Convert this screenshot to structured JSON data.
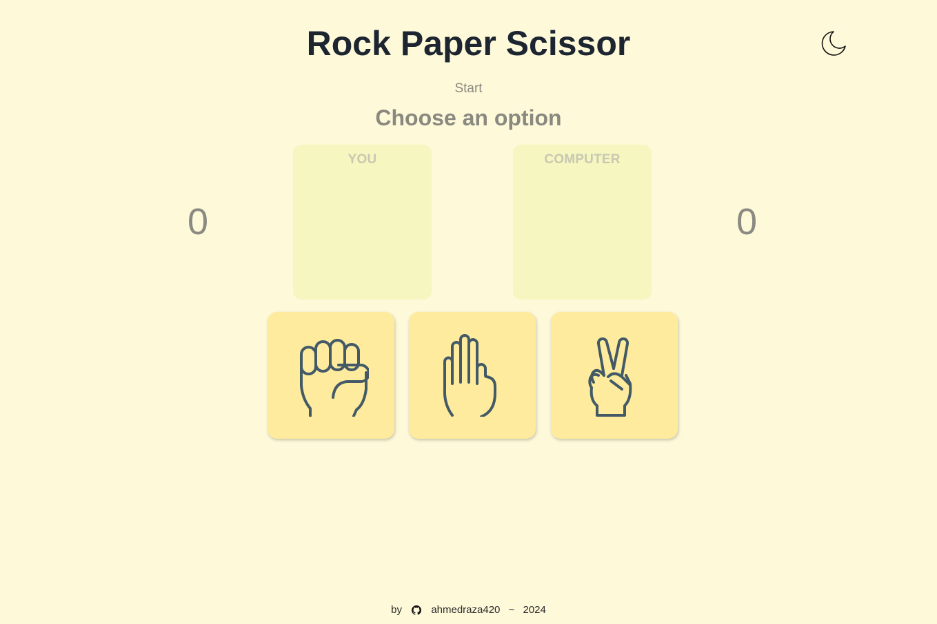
{
  "header": {
    "title": "Rock Paper Scissor",
    "theme_toggle_icon": "moon-icon"
  },
  "game": {
    "status": "Start",
    "prompt": "Choose an option",
    "player": {
      "label": "YOU",
      "score": "0"
    },
    "computer": {
      "label": "COMPUTER",
      "score": "0"
    },
    "options": [
      {
        "name": "rock",
        "icon": "fist-icon"
      },
      {
        "name": "paper",
        "icon": "open-hand-icon"
      },
      {
        "name": "scissor",
        "icon": "peace-hand-icon"
      }
    ]
  },
  "footer": {
    "by": "by",
    "github_icon": "github-icon",
    "author": "ahmedraza420",
    "separator": "~",
    "year": "2024"
  },
  "colors": {
    "background": "#fef9d9",
    "choice_box": "#f6f6c0",
    "option_card": "#feeb9e",
    "icon_stroke": "#435a66"
  }
}
